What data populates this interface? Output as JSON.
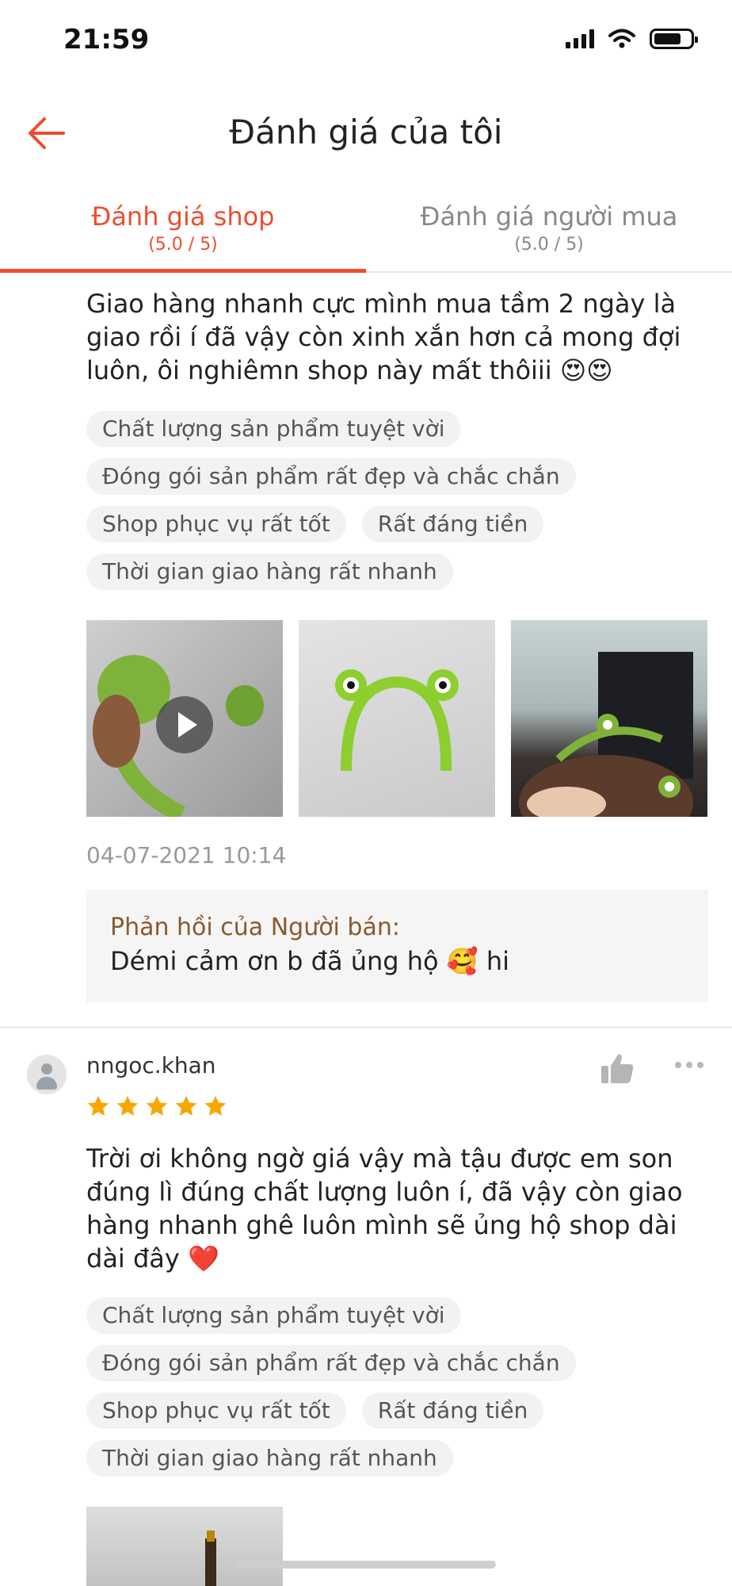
{
  "status_bar": {
    "time": "21:59"
  },
  "header": {
    "title": "Đánh giá của tôi"
  },
  "tabs": [
    {
      "label": "Đánh giá shop",
      "score": "(5.0 / 5)",
      "active": true
    },
    {
      "label": "Đánh giá người mua",
      "score": "(5.0 / 5)",
      "active": false
    }
  ],
  "review1": {
    "text": "Giao hàng nhanh cực mình mua tầm 2 ngày là giao rồi í đã vậy còn xinh xắn hơn cả mong đợi luôn, ôi nghiêmn shop này mất thôiii 😍😍",
    "tags": [
      "Chất lượng sản phẩm tuyệt vời",
      "Đóng gói sản phẩm rất đẹp và chắc chắn",
      "Shop phục vụ rất tốt",
      "Rất đáng tiền",
      "Thời gian giao hàng rất nhanh"
    ],
    "date": "04-07-2021 10:14",
    "seller_reply": {
      "title": "Phản hồi của Người bán:",
      "text": "Démi cảm ơn b đã ủng hộ 🥰 hi"
    }
  },
  "review2": {
    "username": "nngoc.khan",
    "rating": 5,
    "text": "Trời ơi không ngờ giá vậy mà tậu được em son đúng lì đúng chất lượng luôn í, đã vậy còn giao hàng nhanh ghê luôn mình sẽ ủng hộ shop dài dài đây ❤️",
    "tags": [
      "Chất lượng sản phẩm tuyệt vời",
      "Đóng gói sản phẩm rất đẹp và chắc chắn",
      "Shop phục vụ rất tốt",
      "Rất đáng tiền",
      "Thời gian giao hàng rất nhanh"
    ]
  },
  "colors": {
    "accent": "#ee4d2d",
    "star": "#f6a700",
    "reply_title": "#8a5a2b"
  },
  "icons": [
    "back-arrow-icon",
    "play-icon",
    "avatar-icon",
    "thumbs-up-icon",
    "more-icon",
    "star-icon"
  ]
}
